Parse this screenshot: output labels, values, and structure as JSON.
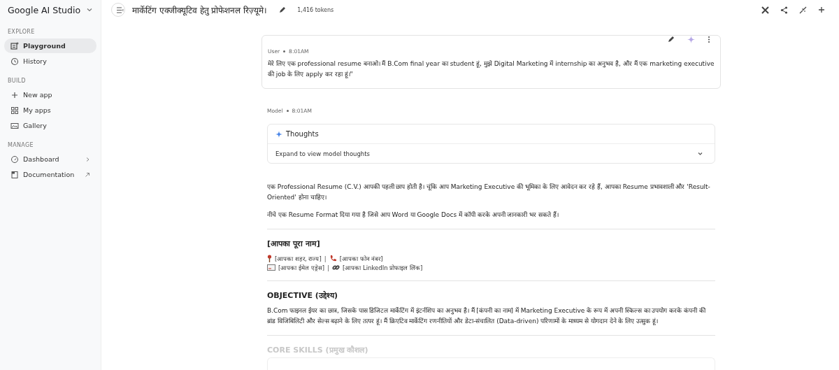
{
  "app": {
    "name": "Google AI Studio"
  },
  "sidebar": {
    "sections": [
      {
        "heading": "EXPLORE",
        "items": [
          {
            "label": "Playground",
            "selected": true
          },
          {
            "label": "History",
            "selected": false
          }
        ]
      },
      {
        "heading": "BUILD",
        "items": [
          {
            "label": "New app",
            "selected": false
          },
          {
            "label": "My apps",
            "selected": false
          },
          {
            "label": "Gallery",
            "selected": false
          }
        ]
      },
      {
        "heading": "MANAGE",
        "items": [
          {
            "label": "Dashboard",
            "selected": false
          },
          {
            "label": "Documentation",
            "selected": false
          }
        ]
      }
    ]
  },
  "header": {
    "title": "मार्केटिंग एक्जीक्यूटिव हेतु प्रोफेशनल रिज़्यूमे।",
    "tokens": "1,416 tokens"
  },
  "user_message": {
    "role": "User",
    "time": "8:01AM",
    "text": "मेरे लिए एक professional resume बनाओ। मैं B.Com final year का student हूं, मुझे Digital Marketing में internship का अनुभव है, और मैं एक marketing executive की job के लिए apply कर रहा हूं।\""
  },
  "model_message": {
    "role": "Model",
    "time": "8:01AM",
    "thoughts": {
      "title": "Thoughts",
      "hint": "Expand to view model thoughts",
      "expanded": false
    },
    "paragraphs": [
      "एक Professional Resume (C.V.) आपकी पहली छाप होती है। चूंकि आप Marketing Executive की भूमिका के लिए आवेदन कर रहे हैं, आपका Resume प्रभावशाली और 'Result-Oriented' होना चाहिए।",
      "नीचे एक Resume Format दिया गया है जिसे आप Word या Google Docs में कॉपी करके अपनी जानकारी भर सकते हैं।"
    ],
    "name_heading": "[आपका पूरा नाम]",
    "separator": "|",
    "contact_lines": [
      [
        {
          "kind": "location",
          "text": "[आपका शहर, राज्य]"
        },
        {
          "kind": "phone",
          "text": "[आपका फोन नंबर]"
        }
      ],
      [
        {
          "kind": "email",
          "text": "[आपका ईमेल एड्रेस]"
        },
        {
          "kind": "link",
          "text": "[आपका LinkedIn प्रोफाइल लिंक]"
        }
      ]
    ],
    "objective_heading": "OBJECTIVE (उद्देश्य)",
    "objective_text": "B.Com फाइनल ईयर का छात्र, जिसके पास डिजिटल मार्केटिंग में इंटर्नशिप का अनुभव है। मैं [कंपनी का नाम] में Marketing Executive के रूप में अपनी स्किल्स का उपयोग करके कंपनी की ब्रांड विजिबिलिटी और सेल्स बढ़ाने के लिए तत्पर हूं। मैं क्रिएटिव मार्केटिंग रणनीतियों और डेटा-संचालित (Data-driven) परिणामों के माध्यम से योगदान देने के लिए उत्सुक हूं।",
    "skills_heading": "CORE SKILLS (प्रमुख कौशल)"
  }
}
